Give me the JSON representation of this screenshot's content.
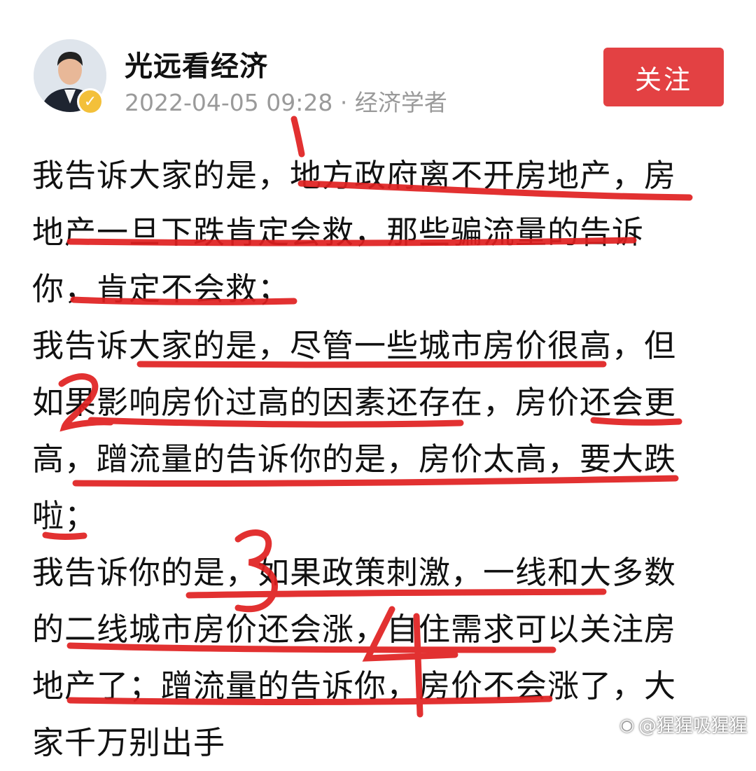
{
  "post": {
    "author": "光远看经济",
    "meta": "2022-04-05 09:28 · 经济学者",
    "follow_label": "关注"
  },
  "body_lines": [
    "我告诉大家的是，地方政府离不开房地产，房",
    "地产一旦下跌肯定会救，那些骗流量的告诉",
    "你，肯定不会救；",
    "我告诉大家的是，尽管一些城市房价很高，但",
    "如果影响房价过高的因素还存在，房价还会更",
    "高，蹭流量的告诉你的是，房价太高，要大跌",
    "啦；",
    "我告诉你的是，如果政策刺激，一线和大多数",
    "的二线城市房价还会涨，自住需求可以关注房",
    "地产了；蹭流量的告诉你，房价不会涨了，大",
    "家千万别出手"
  ],
  "annotations": {
    "numbers": [
      "1",
      "2",
      "3",
      "4"
    ],
    "color": "#e02020"
  },
  "watermark": "@猩猩吸猩猩"
}
